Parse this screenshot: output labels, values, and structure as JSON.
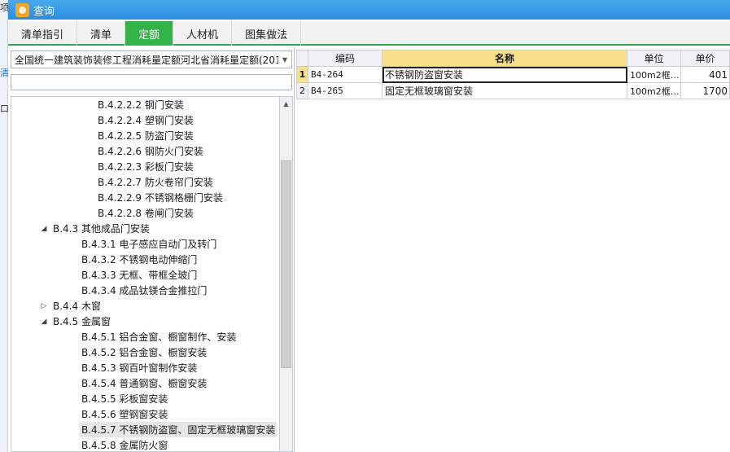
{
  "window": {
    "title": "查询"
  },
  "edge": {
    "chars": [
      "项",
      "清",
      "口"
    ]
  },
  "tabs": [
    {
      "label": "清单指引",
      "active": false
    },
    {
      "label": "清单",
      "active": false
    },
    {
      "label": "定额",
      "active": true
    },
    {
      "label": "人材机",
      "active": false
    },
    {
      "label": "图集做法",
      "active": false
    }
  ],
  "left": {
    "library_select": "全国统一建筑装饰装修工程消耗量定额河北省消耗量定额(201",
    "search_value": "",
    "tree": [
      {
        "label": "B.4.2.2.2 钢门安装",
        "level": 3,
        "toggle": ""
      },
      {
        "label": "B.4.2.2.4 塑钢门安装",
        "level": 3,
        "toggle": ""
      },
      {
        "label": "B.4.2.2.5 防盗门安装",
        "level": 3,
        "toggle": ""
      },
      {
        "label": "B.4.2.2.6 钢防火门安装",
        "level": 3,
        "toggle": ""
      },
      {
        "label": "B.4.2.2.3 彩板门安装",
        "level": 3,
        "toggle": ""
      },
      {
        "label": "B.4.2.2.7 防火卷帘门安装",
        "level": 3,
        "toggle": ""
      },
      {
        "label": "B.4.2.2.9 不锈钢格栅门安装",
        "level": 3,
        "toggle": ""
      },
      {
        "label": "B.4.2.2.8 卷闸门安装",
        "level": 3,
        "toggle": ""
      },
      {
        "label": "B.4.3 其他成品门安装",
        "level": 1,
        "toggle": "◢"
      },
      {
        "label": "B.4.3.1 电子感应自动门及转门",
        "level": 2,
        "toggle": ""
      },
      {
        "label": "B.4.3.2 不锈钢电动伸缩门",
        "level": 2,
        "toggle": ""
      },
      {
        "label": "B.4.3.3 无框、带框全玻门",
        "level": 2,
        "toggle": ""
      },
      {
        "label": "B.4.3.4 成品钛镁合金推拉门",
        "level": 2,
        "toggle": ""
      },
      {
        "label": "B.4.4 木窗",
        "level": 1,
        "toggle": "▷"
      },
      {
        "label": "B.4.5 金属窗",
        "level": 1,
        "toggle": "◢"
      },
      {
        "label": "B.4.5.1 铝合金窗、橱窗制作、安装",
        "level": 2,
        "toggle": ""
      },
      {
        "label": "B.4.5.2 铝合金窗、橱窗安装",
        "level": 2,
        "toggle": ""
      },
      {
        "label": "B.4.5.3 钢百叶窗制作安装",
        "level": 2,
        "toggle": ""
      },
      {
        "label": "B.4.5.4 普通钢窗、橱窗安装",
        "level": 2,
        "toggle": ""
      },
      {
        "label": "B.4.5.5 彩板窗安装",
        "level": 2,
        "toggle": ""
      },
      {
        "label": "B.4.5.6 塑钢窗安装",
        "level": 2,
        "toggle": ""
      },
      {
        "label": "B.4.5.7 不锈钢防盗窗、固定无框玻璃窗安装",
        "level": 2,
        "toggle": "",
        "selected": true
      },
      {
        "label": "B.4.5.8 金属防火窗",
        "level": 2,
        "toggle": ""
      }
    ]
  },
  "grid": {
    "columns": [
      "编码",
      "名称",
      "单位",
      "单价"
    ],
    "rows": [
      {
        "num": "1",
        "code": "B4-264",
        "name": "不锈钢防盗窗安装",
        "unit": "100m2框…",
        "price": "401",
        "current": true
      },
      {
        "num": "2",
        "code": "B4-265",
        "name": "固定无框玻璃窗安装",
        "unit": "100m2框…",
        "price": "1700",
        "current": false
      }
    ]
  },
  "colors": {
    "titlebar": "#2a8ddf",
    "active_tab": "#33b34a",
    "header_highlight": "#f8e08a"
  },
  "icons": {
    "scroll_up": "▲",
    "dropdown": "▼"
  }
}
